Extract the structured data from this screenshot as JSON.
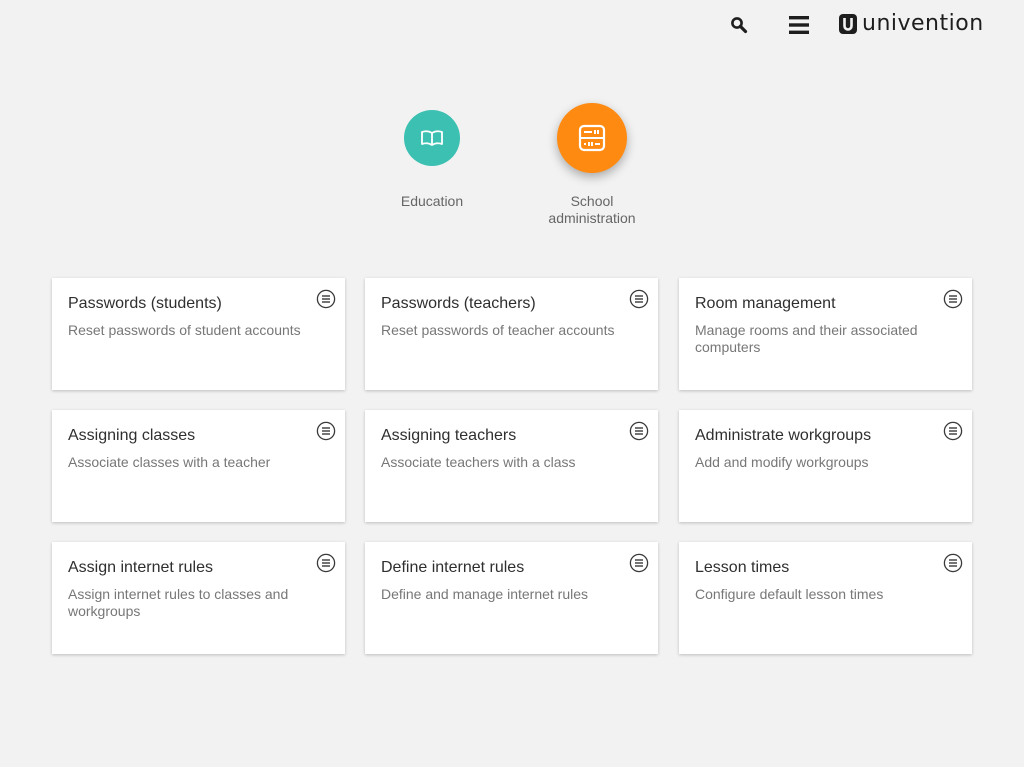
{
  "header": {
    "search_icon": "search-icon",
    "menu_icon": "hamburger-menu-icon",
    "logo_text": "univention"
  },
  "categories": [
    {
      "label": "Education",
      "icon": "book-icon",
      "color": "#3cc0b2"
    },
    {
      "label": "School administration",
      "icon": "abacus-icon",
      "color": "#ff8a12"
    }
  ],
  "tiles": [
    {
      "title": "Passwords (students)",
      "description": "Reset passwords of student accounts"
    },
    {
      "title": "Passwords (teachers)",
      "description": "Reset passwords of teacher accounts"
    },
    {
      "title": "Room management",
      "description": "Manage rooms and their associated computers"
    },
    {
      "title": "Assigning classes",
      "description": "Associate classes with a teacher"
    },
    {
      "title": "Assigning teachers",
      "description": "Associate teachers with a class"
    },
    {
      "title": "Administrate workgroups",
      "description": "Add and modify workgroups"
    },
    {
      "title": "Assign internet rules",
      "description": "Assign internet rules to classes and workgroups"
    },
    {
      "title": "Define internet rules",
      "description": "Define and manage internet rules"
    },
    {
      "title": "Lesson times",
      "description": "Configure default lesson times"
    }
  ]
}
